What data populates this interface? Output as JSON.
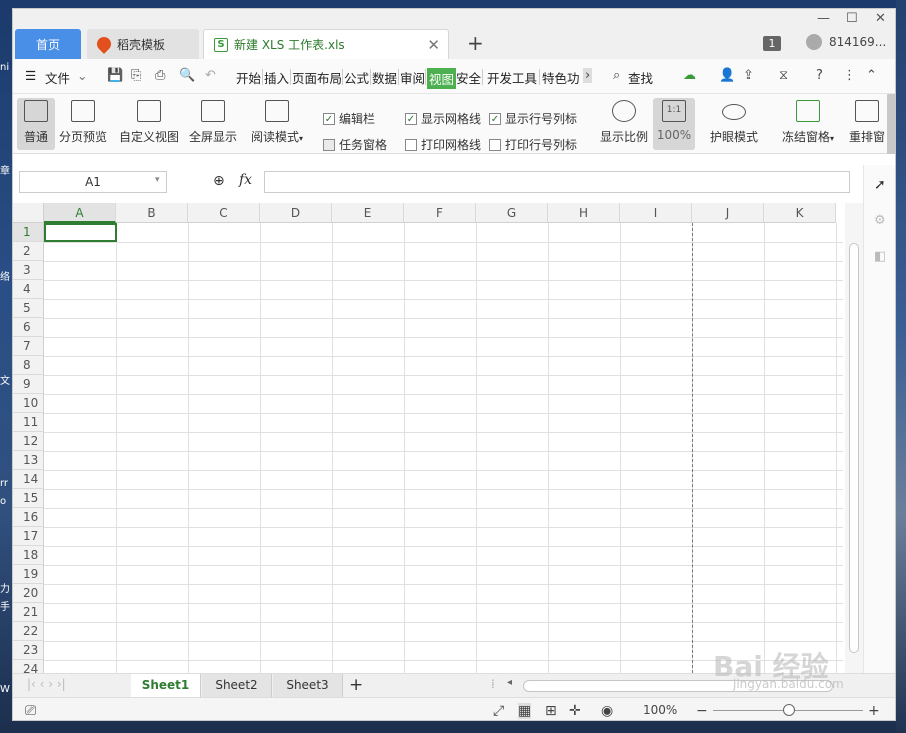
{
  "desktop": {
    "fragments": [
      "ni",
      "章",
      "络",
      "文",
      "rr",
      "o",
      "力",
      "手",
      "W"
    ]
  },
  "window": {
    "tabs": {
      "home": "首页",
      "template": "稻壳模板",
      "file": "新建 XLS 工作表.xls"
    },
    "badge_count": "1",
    "user_id": "814169..."
  },
  "menu": {
    "file": "文件",
    "items": [
      "开始",
      "插入",
      "页面布局",
      "公式",
      "数据",
      "审阅",
      "视图",
      "安全",
      "开发工具",
      "特色功"
    ],
    "active": "视图",
    "search": "查找"
  },
  "ribbon": {
    "buttons": [
      {
        "label": "普通",
        "icon": "normal-view-icon"
      },
      {
        "label": "分页预览",
        "icon": "page-break-preview-icon"
      },
      {
        "label": "自定义视图",
        "icon": "custom-view-icon"
      },
      {
        "label": "全屏显示",
        "icon": "fullscreen-icon"
      },
      {
        "label": "阅读模式",
        "icon": "reading-mode-icon"
      }
    ],
    "checkboxes": [
      {
        "label": "编辑栏",
        "checked": true
      },
      {
        "label": "任务窗格",
        "checked": false
      },
      {
        "label": "显示网格线",
        "checked": true
      },
      {
        "label": "打印网格线",
        "checked": false
      },
      {
        "label": "显示行号列标",
        "checked": true
      },
      {
        "label": "打印行号列标",
        "checked": false
      }
    ],
    "zoom_label": "显示比例",
    "zoom_value": "100%",
    "zoom_glyph": "1:1",
    "eye_mode": "护眼模式",
    "freeze": "冻结窗格",
    "rearrange": "重排窗"
  },
  "formula_bar": {
    "name_box": "A1",
    "fx": "fx",
    "value": ""
  },
  "grid": {
    "columns": [
      "A",
      "B",
      "C",
      "D",
      "E",
      "F",
      "G",
      "H",
      "I",
      "J",
      "K"
    ],
    "rows": [
      "1",
      "2",
      "3",
      "4",
      "5",
      "6",
      "7",
      "8",
      "9",
      "10",
      "11",
      "12",
      "13",
      "14",
      "15",
      "16",
      "17",
      "18",
      "19",
      "20",
      "21",
      "22",
      "23",
      "24"
    ]
  },
  "sheets": [
    "Sheet1",
    "Sheet2",
    "Sheet3"
  ],
  "status": {
    "zoom": "100%"
  },
  "watermark": {
    "brand": "Bai 经验",
    "url": "jingyan.baidu.com"
  }
}
